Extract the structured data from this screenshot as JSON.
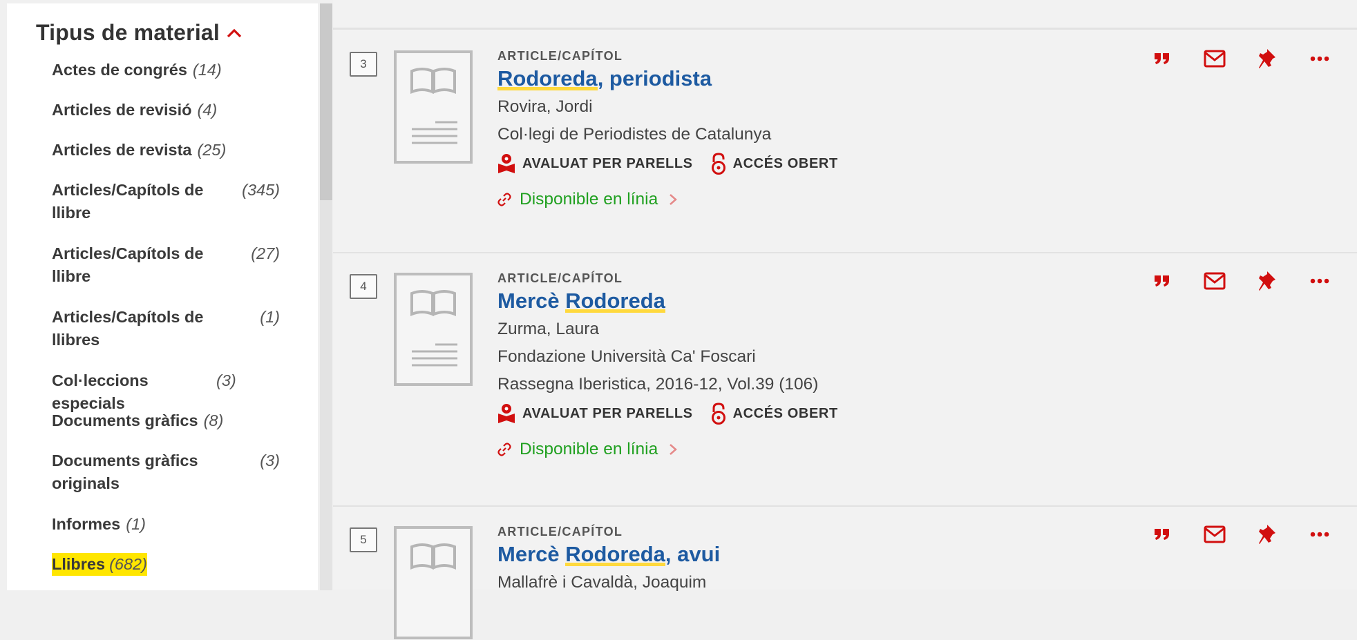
{
  "facets": {
    "title": "Tipus de material",
    "items": [
      {
        "label": "Actes de congrés",
        "count": "(14)"
      },
      {
        "label": "Articles de revisió",
        "count": "(4)"
      },
      {
        "label": "Articles de revista",
        "count": "(25)"
      },
      {
        "label": "Articles/Capítols de llibre",
        "count": "(345)"
      },
      {
        "label": "Articles/Capítols de llibre",
        "count": "(27)"
      },
      {
        "label": "Articles/Capítols de llibres",
        "count": "(1)"
      },
      {
        "label": "Col·leccions especials",
        "count": "(3)"
      },
      {
        "label": "Documents gràfics",
        "count": "(8)"
      },
      {
        "label": "Documents gràfics originals",
        "count": "(3)"
      },
      {
        "label": "Informes",
        "count": "(1)"
      },
      {
        "label": "Llibres",
        "count": "(682)"
      }
    ]
  },
  "results": [
    {
      "number": "3",
      "type": "ARTICLE/CAPÍTOL",
      "title_hl": "Rodoreda",
      "title_rest": ", periodista",
      "author": "Rovira, Jordi",
      "publisher": "Col·legi de Periodistes de Catalunya",
      "peer_review": "AVALUAT PER PARELLS",
      "open_access": "ACCÉS OBERT",
      "availability": "Disponible en línia"
    },
    {
      "number": "4",
      "type": "ARTICLE/CAPÍTOL",
      "title_pre": "Mercè ",
      "title_hl": "Rodoreda",
      "author": "Zurma, Laura",
      "publisher": "Fondazione Università Ca' Foscari",
      "source": "Rassegna Iberistica, 2016-12, Vol.39 (106)",
      "peer_review": "AVALUAT PER PARELLS",
      "open_access": "ACCÉS OBERT",
      "availability": "Disponible en línia"
    },
    {
      "number": "5",
      "type": "ARTICLE/CAPÍTOL",
      "title_pre": "Mercè ",
      "title_hl": "Rodoreda",
      "title_rest": ", avui",
      "author": "Mallafrè i Cavaldà, Joaquim"
    }
  ],
  "colors": {
    "accent_red": "#d10f0f",
    "link_blue": "#1d5aa1",
    "available_green": "#20a020",
    "highlight_yellow": "#ffe600"
  },
  "icons": [
    "chevron-up-icon",
    "book-placeholder-icon",
    "peer-review-icon",
    "open-lock-icon",
    "link-icon",
    "chevron-right-icon",
    "quote-icon",
    "mail-icon",
    "pin-icon",
    "more-icon"
  ]
}
